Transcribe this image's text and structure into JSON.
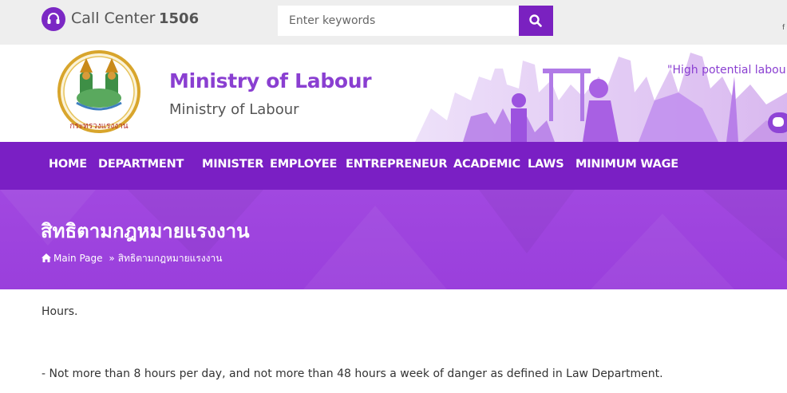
{
  "topbar": {
    "call_center_label": "Call Center",
    "call_center_number": "1506",
    "call_icon": "headset-icon",
    "search": {
      "placeholder": "Enter keywords",
      "value": ""
    },
    "search_icon": "search-icon",
    "side_letter": "f"
  },
  "header": {
    "logo_icon": "ministry-seal-logo",
    "title": "Ministry of Labour",
    "subtitle": "Ministry of Labour",
    "slogan": "\"High potential labou",
    "line_icon": "line-chat-icon"
  },
  "nav": {
    "items": [
      {
        "label": "HOME"
      },
      {
        "label": "DEPARTMENT"
      },
      {
        "label": "MINISTER"
      },
      {
        "label": "EMPLOYEE"
      },
      {
        "label": "ENTREPRENEUR"
      },
      {
        "label": "ACADEMIC"
      },
      {
        "label": "LAWS"
      },
      {
        "label": "MINIMUM WAGE"
      }
    ]
  },
  "banner": {
    "title": "สิทธิตามกฎหมายแรงงาน",
    "breadcrumb": {
      "home_icon": "home-icon",
      "home": "Main Page",
      "separator": "»",
      "current": "สิทธิตามกฎหมายแรงงาน"
    }
  },
  "content": {
    "paragraphs": [
      "Hours.",
      "- Not more than 8 hours per day, and not more than 48 hours a week of danger as defined in Law Department."
    ]
  },
  "colors": {
    "brand_purple": "#7a1fc4",
    "banner_purple": "#a148e0",
    "title_purple": "#8a3fd1",
    "topbar_gray": "#eeeeee"
  }
}
